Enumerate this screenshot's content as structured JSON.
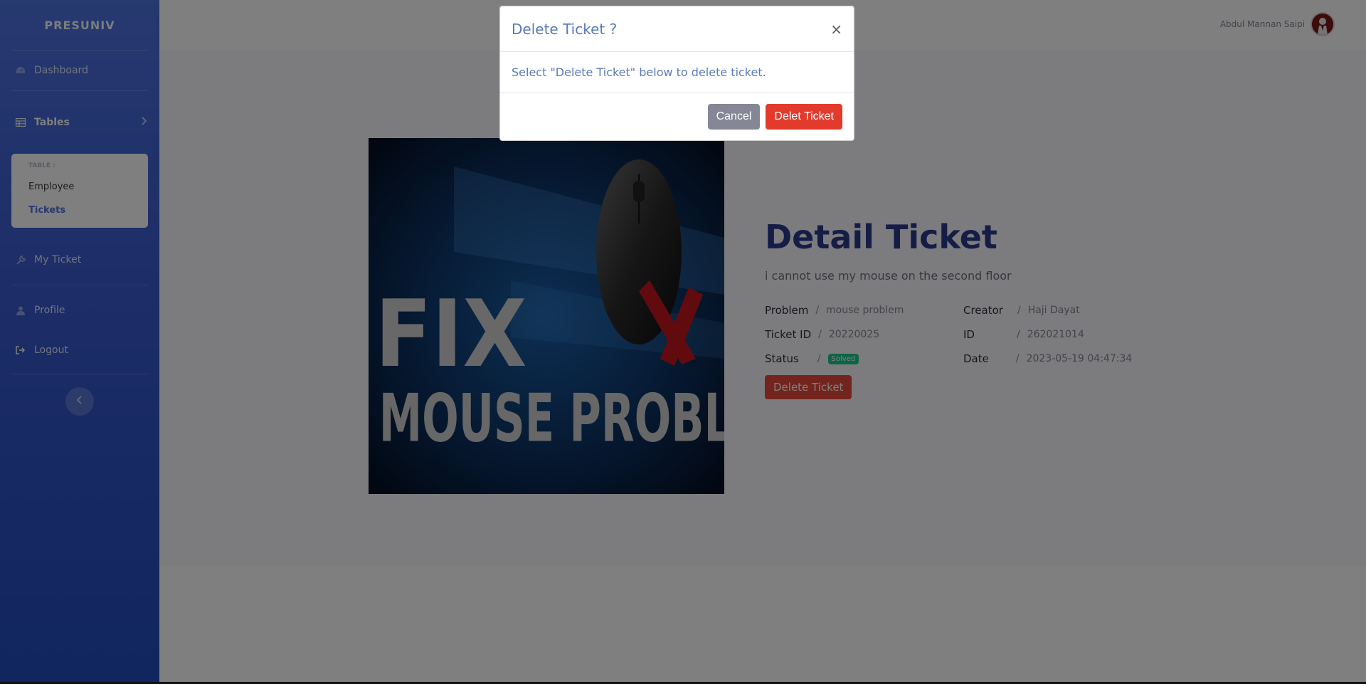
{
  "sidebar": {
    "brand": "PRESUNIV",
    "dashboard": "Dashboard",
    "tables": "Tables",
    "collapse_header": "TABLE :",
    "employee": "Employee",
    "tickets": "Tickets",
    "my_ticket": "My Ticket",
    "profile": "Profile",
    "logout": "Logout"
  },
  "topbar": {
    "user_name": "Abdul Mannan Saipi"
  },
  "image": {
    "line1": "FIX",
    "line2": "MOUSE PROBLEM"
  },
  "detail": {
    "title": "Detail Ticket",
    "description": "i cannot use my mouse on the second floor",
    "problem_label": "Problem",
    "problem_value": "mouse problem",
    "creator_label": "Creator",
    "creator_value": "Haji Dayat",
    "ticket_id_label": "Ticket ID",
    "ticket_id_value": "20220025",
    "id_label": "ID",
    "id_value": "262021014",
    "status_label": "Status",
    "status_value": "Solved",
    "date_label": "Date",
    "date_value": "2023-05-19 04:47:34",
    "separator": "/",
    "delete_button": "Delete Ticket"
  },
  "modal": {
    "title": "Delete Ticket ?",
    "close": "×",
    "body": "Select \"Delete Ticket\" below to delete ticket.",
    "cancel": "Cancel",
    "confirm": "Delet Ticket"
  },
  "colors": {
    "sidebar": "#4e73df",
    "danger": "#e74a3b",
    "success": "#1cc88a",
    "title": "#2b3a8f"
  }
}
